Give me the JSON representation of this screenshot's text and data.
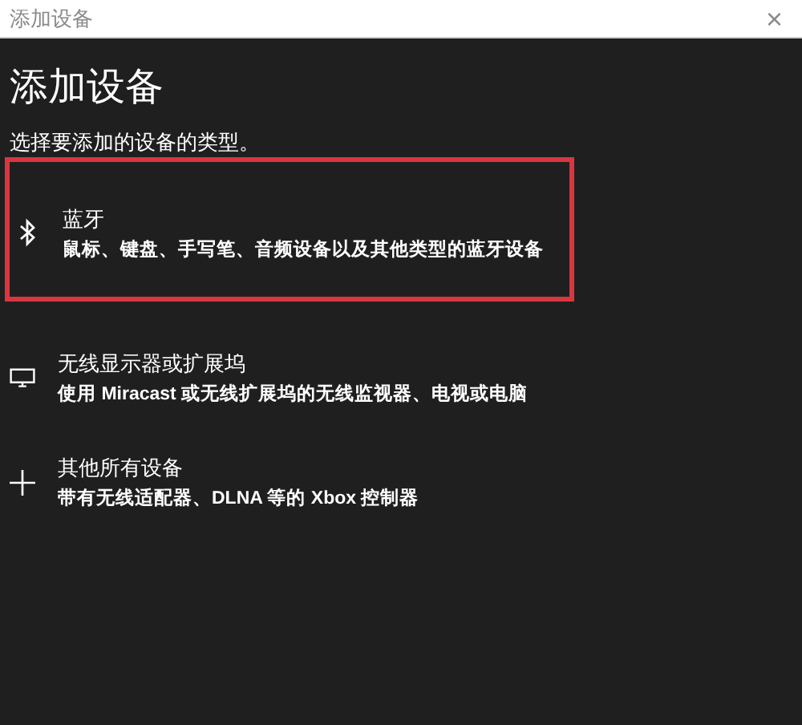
{
  "window": {
    "title": "添加设备",
    "close": "×"
  },
  "heading": "添加设备",
  "subtitle": "选择要添加的设备的类型。",
  "items": [
    {
      "kind": "bluetooth",
      "title": "蓝牙",
      "description": "鼠标、键盘、手写笔、音频设备以及其他类型的蓝牙设备",
      "highlighted": true
    },
    {
      "kind": "display",
      "title": "无线显示器或扩展坞",
      "description": "使用 Miracast 或无线扩展坞的无线监视器、电视或电脑",
      "highlighted": false
    },
    {
      "kind": "other",
      "title": "其他所有设备",
      "description": "带有无线适配器、DLNA 等的 Xbox 控制器",
      "highlighted": false
    }
  ]
}
